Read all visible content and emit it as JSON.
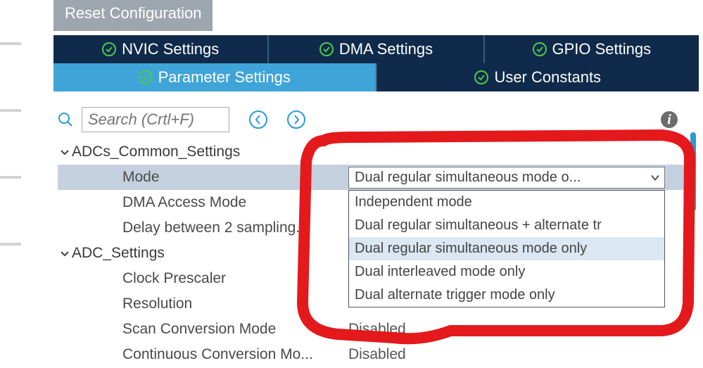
{
  "reset_button": "Reset Configuration",
  "tabs_row1": [
    {
      "label": "NVIC Settings"
    },
    {
      "label": "DMA Settings"
    },
    {
      "label": "GPIO Settings"
    }
  ],
  "tabs_row2": [
    {
      "label": "Parameter Settings"
    },
    {
      "label": "User Constants"
    }
  ],
  "search": {
    "placeholder": "Search (Crtl+F)"
  },
  "groups": [
    {
      "title": "ADCs_Common_Settings",
      "rows": [
        {
          "label": "Mode",
          "value": "Dual regular simultaneous mode o..."
        },
        {
          "label": "DMA Access Mode",
          "value": ""
        },
        {
          "label": "Delay between 2 sampling...",
          "value": ""
        }
      ]
    },
    {
      "title": "ADC_Settings",
      "rows": [
        {
          "label": "Clock Prescaler",
          "value": ""
        },
        {
          "label": "Resolution",
          "value": ""
        },
        {
          "label": "Scan Conversion Mode",
          "value": "Disabled"
        },
        {
          "label": "Continuous Conversion Mo...",
          "value": "Disabled"
        }
      ]
    }
  ],
  "dropdown": {
    "options": [
      "Independent mode",
      "Dual regular simultaneous + alternate tr",
      "Dual regular simultaneous mode only",
      "Dual interleaved mode only",
      "Dual alternate trigger mode only"
    ],
    "selected_index": 2
  }
}
